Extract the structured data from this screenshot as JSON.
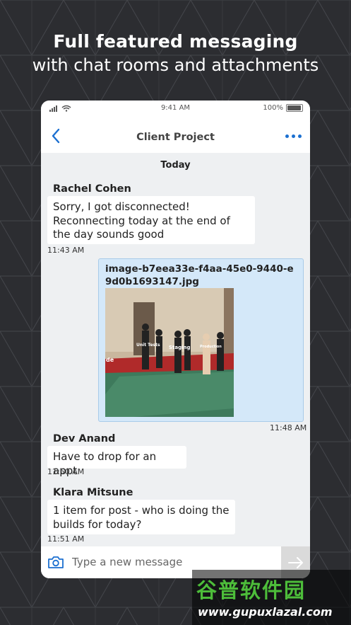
{
  "promo": {
    "headline": "Full featured messaging",
    "subheadline": "with chat rooms and attachments"
  },
  "status_bar": {
    "time": "9:41 AM",
    "battery": "100%"
  },
  "nav": {
    "title": "Client Project",
    "back_icon": "chevron-left-icon",
    "more_icon": "more-dots-icon",
    "accent_color": "#1b6fd0"
  },
  "day_separator": "Today",
  "messages": [
    {
      "sender": "Rachel Cohen",
      "text": "Sorry, I got disconnected! Reconnecting today at the end of the day sounds good",
      "time": "11:43 AM"
    },
    {
      "attachment_name": "image-b7eea33e-f4aa-45e0-9440-e9d0b1693147.jpg",
      "time": "11:48 AM",
      "image_labels": [
        "Unit Tests",
        "Staging",
        "Production"
      ],
      "image_corner_text": "de"
    },
    {
      "sender": "Dev Anand",
      "text": "Have to drop for an appt",
      "time": "11:50 AM"
    },
    {
      "sender": "Klara Mitsune",
      "text": "1 item for post - who is doing the builds for today?",
      "time": "11:51 AM"
    }
  ],
  "composer": {
    "placeholder": "Type a new message",
    "camera_icon": "camera-icon",
    "send_icon": "send-arrow-icon"
  },
  "watermark": {
    "title": "谷普软件园",
    "url": "www.gupuxlazal.com"
  }
}
